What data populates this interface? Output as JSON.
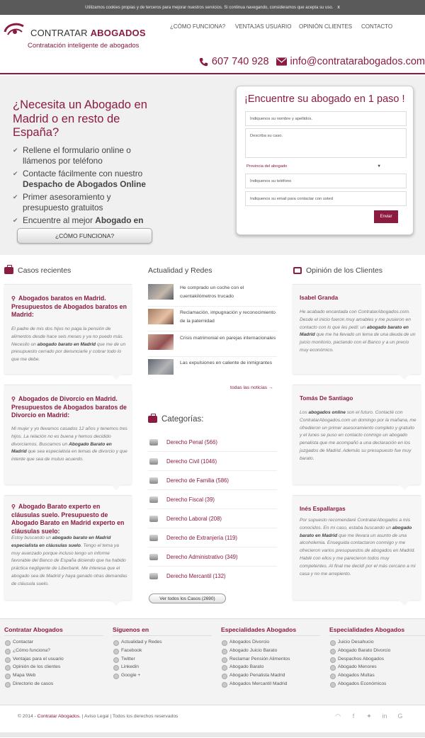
{
  "cookie": {
    "text": "Utilizamos cookies propias y de terceros para mejorar nuestros servicios. Si continua navegando, consideramos que acepta su uso.",
    "close": "x"
  },
  "brand": {
    "name_light": "CONTRATAR",
    "name_bold": "ABOGADOS",
    "tagline": "Contratación inteligente de abogados"
  },
  "nav": [
    "¿CÓMO FUNCIONA?",
    "VENTAJAS USUARIO",
    "OPINIÓN CLIENTES",
    "CONTACTO"
  ],
  "contact": {
    "phone": "607 740 928",
    "email": "info@contratarabogados.com"
  },
  "hero": {
    "title": "¿Necesita un Abogado en Madrid o en resto de España?",
    "checks": [
      {
        "text": "Rellene el formulario online o llámenos por teléfono",
        "bold": ""
      },
      {
        "text": "Contacte fácilmente con nuestro",
        "bold": "Despacho de Abogados Online"
      },
      {
        "text": "Primer asesoramiento y presupuesto gratuitos",
        "bold": ""
      },
      {
        "text": "Encuentre al mejor",
        "bold": "Abogado en"
      }
    ],
    "button": "¿CÓMO FUNCIONA?"
  },
  "form": {
    "title": "¡Encuentre su abogado en 1 paso !",
    "name_placeholder": "Indiquenos su nombre y apellidos.",
    "case_placeholder": "Describa su caso.",
    "province_label": "Provincia del abogado",
    "phone_placeholder": "Indiquenos su teléfono",
    "email_placeholder": "Indiquenos su email para contactar con usted",
    "submit": "Enviar"
  },
  "cases": {
    "title": "Casos recientes",
    "items": [
      {
        "title": "Abogados baratos en Madrid. Presupuestos de Abogados baratos en Madrid:",
        "pre": "El padre de mis dos hijos no paga la pensión de alimentos desde hace seis meses y ya no puedo más. Necesito un ",
        "bold": "abogado barato en Madrid",
        "post": " que me de un presupuesto cerrado por denunciarle y cobrar todo lo que me debe."
      },
      {
        "title": "Abogados de Divorcio en Madrid. Presupuestos de Abogados baratos de Divorcio en Madrid:",
        "pre": "Mi mujer y yo llevamos casados 12 años y tenemos tres hijos. La relación no es buena y hemos decidido divorciarnos. Buscamos un ",
        "bold": "Abogado Barato en Madrid",
        "post": " que sea especialista en temas de divorcio y que intente que sea de mutuo acuerdo."
      },
      {
        "title": "Abogado Barato experto en cláusulas suelo. Presupuesto de Abogado Barato en Madrid experto en cláusulas suelo:",
        "pre": "Estoy buscando un ",
        "bold": "abogado barato en Madrid especialista en cláusulas suelo",
        "post": ". Tengo el tema ya muy avanzado porque incluso tengo un informe favorable del Banco de España diciendo que ha habido práctica negligente de Liberbank. Me interesa que el abogado sea de Madrid y haya ganado otras demandas de cláusula suelo."
      }
    ]
  },
  "news": {
    "title": "Actualidad y Redes",
    "items": [
      "He comprado un coche con el cuentakilómetros trucado",
      "Reclamación, impugnación y reconocimiento de la paternidad",
      "Crisis matrimonial en parejas internacionales",
      "Las expulsiones en caliente de inmigrantes"
    ],
    "more": "todas las noticias →"
  },
  "categories": {
    "title": "Categorías:",
    "items": [
      "Derecho Penal (566)",
      "Derecho Civil (1046)",
      "Derecho de Familia (586)",
      "Derecho Fiscal (39)",
      "Derecho Laboral (208)",
      "Derecho de Extranjería (119)",
      "Derecho Administrativo (349)",
      "Derecho Mercantil (132)"
    ],
    "button": "Ver todos los Casos (2690)"
  },
  "opinions": {
    "title": "Opinión de los Clientes",
    "items": [
      {
        "name": "Isabel Granda",
        "pre": "He acabado encantada con ContratarAbogados.com. Desde el inicio fueron muy amables y me pusieron en contacto con lo que les pedí: un ",
        "bold": "abogado barato en Madrid",
        "post": " que me ha llevado un tema de una deuda de un juicio monitorio, pactando con el Banco y a un precio muy económico."
      },
      {
        "name": "Tomás De Santiago",
        "pre": "Los ",
        "bold": "abogados online",
        "post": " son el futuro. Contacté con ContratarAbogados.com un domingo por la mañana, me ofredieron un primer asesoramiento completo y gratuito y el lunes se puso en contacto conmigo un abogado penalista que me acompañó a una declaración en los juzgados de Madrid. Además su presupuesto fue muy barato."
      },
      {
        "name": "Inés Espallargas",
        "pre": "Por supuesto recomendaré ContratarAbogados a mis conocidos. En mi caso, estaba buscando un ",
        "bold": "abogado barato en Madrid",
        "post": " que me llevara un asunto de una alcoholemia. Enseguida contactaron conmigo y me ofrecieron varios presupuestos de abogados en Madrid. Hablé con ellos y me parecieron todos muy competentes. Al final me decidí por el más cercano a mi casa y no me arrepiento."
      }
    ]
  },
  "footer": {
    "cols": [
      {
        "title": "Contratar Abogados",
        "items": [
          "Contactar",
          "¿Cómo funciona?",
          "Ventajas para el usuario",
          "Opinión de los clientes",
          "Mapa Web",
          "Directorio de casos"
        ]
      },
      {
        "title": "Síguenos en",
        "items": [
          "Actualidad y Redes",
          "Facebook",
          "Twitter",
          "Linkedin",
          "Google +"
        ]
      },
      {
        "title": "Especialidades Abogados",
        "items": [
          "Abogados Divorcio",
          "Abogado Juicio Barato",
          "Reclamar Pensión Alimentos",
          "Abogado Barato",
          "Abogado Penalista Madrid",
          "Abogados Mercantil Madrid"
        ]
      },
      {
        "title": "Especialidades Abogados",
        "items": [
          "Juicio Desahucio",
          "Abogado Barato Divorcio",
          "Despachos Abogados",
          "Abogado Menores",
          "Abogados Multas",
          "Abogados Económicos"
        ]
      }
    ],
    "copyright_pre": "© 2014 - ",
    "copyright_link": "Contratar Abogados.",
    "copyright_post": " | Aviso Legal | Todos los derechos reservados"
  }
}
